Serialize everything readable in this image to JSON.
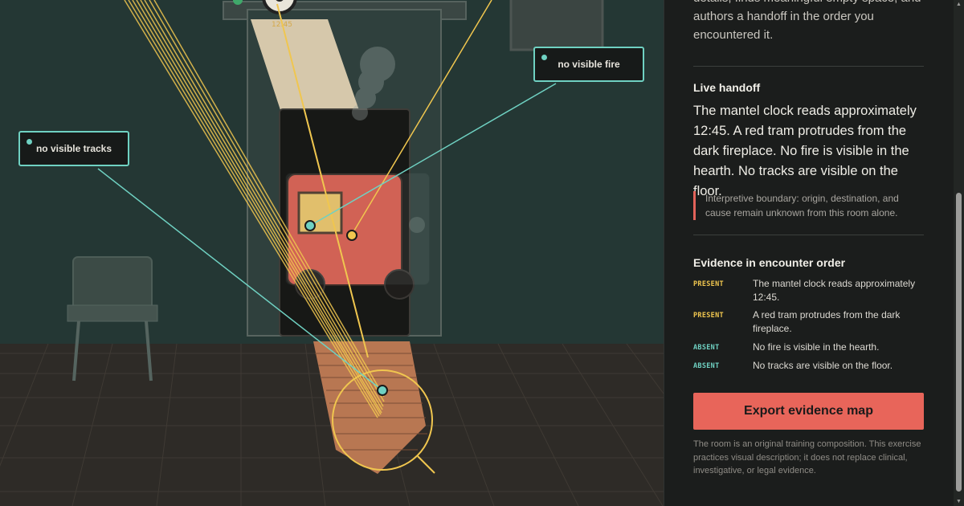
{
  "callouts": {
    "fire": "no visible fire",
    "tracks": "no visible tracks"
  },
  "panel": {
    "intro_text": "details, finds meaningful empty space, and authors a handoff in the order you encountered it.",
    "live_handoff": {
      "heading": "Live handoff",
      "text": "The mantel clock reads approximately 12:45. A red tram protrudes from the dark fireplace. No fire is visible in the hearth. No tracks are visible on the floor.",
      "boundary": "Interpretive boundary: origin, destination, and cause remain unknown from this room alone."
    },
    "evidence": {
      "heading": "Evidence in encounter order",
      "items": [
        {
          "tag": "PRESENT",
          "text": "The mantel clock reads approximately 12:45."
        },
        {
          "tag": "PRESENT",
          "text": "A red tram protrudes from the dark fireplace."
        },
        {
          "tag": "ABSENT",
          "text": "No fire is visible in the hearth."
        },
        {
          "tag": "ABSENT",
          "text": "No tracks are visible on the floor."
        }
      ]
    },
    "export_button": "Export evidence map",
    "footnote": "The room is an original training composition. This exercise practices visual description; it does not replace clinical, investigative, or legal evidence."
  },
  "colors": {
    "accent_red": "#e8655a",
    "present_yellow": "#f0c64f",
    "absent_teal": "#6fd1c2"
  }
}
